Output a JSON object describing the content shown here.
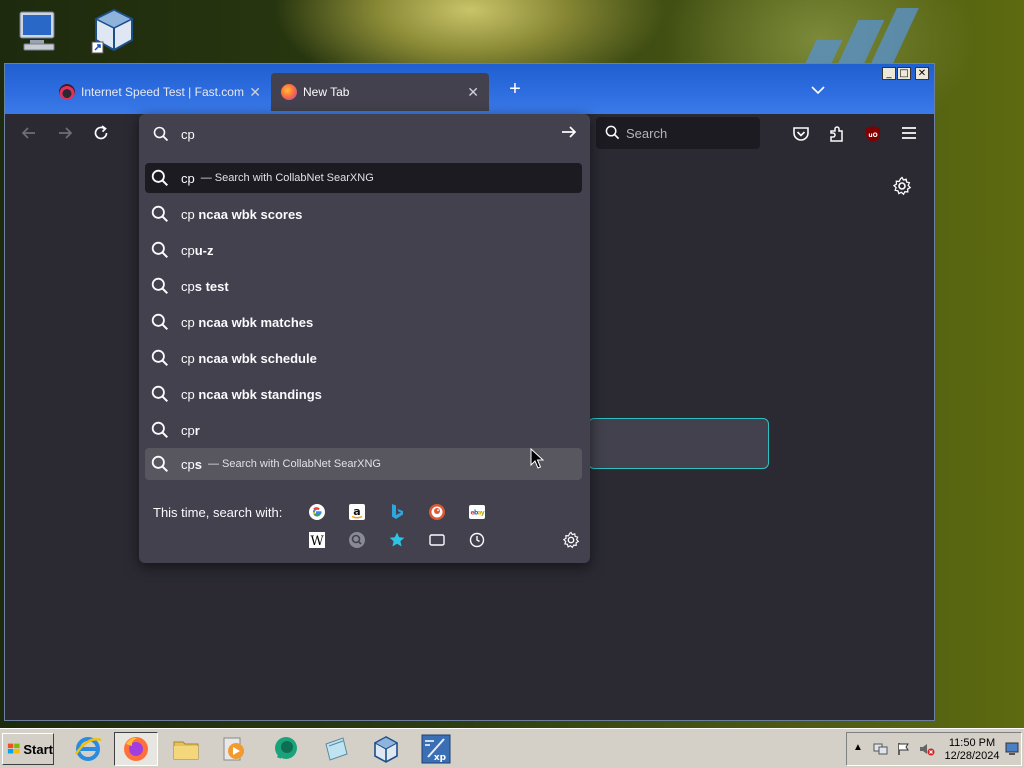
{
  "window": {
    "controls": {
      "minimize": "_",
      "maximize": "□",
      "close": "✕"
    }
  },
  "tabs": [
    {
      "title": "Internet Speed Test | Fast.com",
      "active": false
    },
    {
      "title": "New Tab",
      "active": true
    }
  ],
  "toolbar": {
    "url_text": "cp",
    "search_placeholder": "Search"
  },
  "suggestions": [
    {
      "typed": "cp",
      "rest": "",
      "action": "— Search with CollabNet SearXNG",
      "highlight": "dark"
    },
    {
      "typed": "cp",
      "rest": " ncaa wbk scores",
      "action": ""
    },
    {
      "typed": "cp",
      "rest": "u-z",
      "action": ""
    },
    {
      "typed": "cp",
      "rest": "s test",
      "action": ""
    },
    {
      "typed": "cp",
      "rest": " ncaa wbk matches",
      "action": ""
    },
    {
      "typed": "cp",
      "rest": " ncaa wbk schedule",
      "action": ""
    },
    {
      "typed": "cp",
      "rest": " ncaa wbk standings",
      "action": ""
    },
    {
      "typed": "cp",
      "rest": "r",
      "action": ""
    },
    {
      "typed": "cp",
      "rest": "s",
      "action": "— Search with CollabNet SearXNG",
      "highlight": "hover"
    }
  ],
  "one_off": {
    "label": "This time, search with:",
    "engines_row1": [
      "google-icon",
      "amazon-icon",
      "bing-icon",
      "duckduckgo-icon",
      "ebay-icon"
    ],
    "engines_row2": [
      "wikipedia-icon",
      "searxng-icon",
      "bookmarks-star-icon",
      "tabs-icon",
      "history-clock-icon"
    ]
  },
  "taskbar": {
    "start_label": "Start",
    "time": "11:50 PM",
    "date": "12/28/2024"
  },
  "colors": {
    "accent_focus": "#2dc1c1",
    "titlebar": "#2f6ee0",
    "panel": "#42414d",
    "toolbar": "#2b2a33"
  }
}
